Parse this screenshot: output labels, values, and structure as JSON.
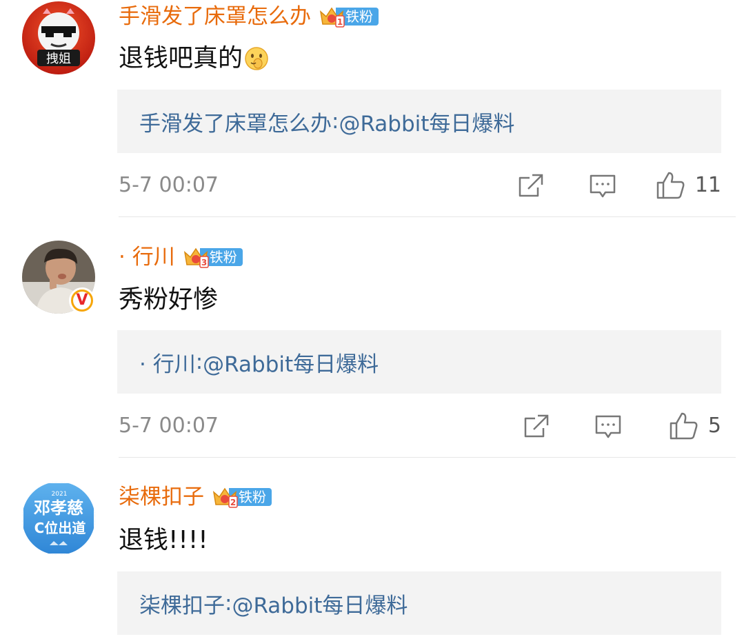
{
  "comments": [
    {
      "username": "手滑发了床罩怎么办",
      "badge_label": "铁粉",
      "badge_level": "1",
      "avatar_text": "拽姐",
      "text": "退钱吧真的",
      "emoji": "smirk-emoji",
      "quote_name": "手滑发了床罩怎么办",
      "quote_sep": ": ",
      "quote_mention": "@Rabbit每日爆料",
      "time": "5-7 00:07",
      "like_count": "11",
      "verified": false
    },
    {
      "username": "· 行川",
      "badge_label": "铁粉",
      "badge_level": "3",
      "avatar_text": "",
      "text": "秀粉好惨",
      "quote_name": "· 行川",
      "quote_sep": ": ",
      "quote_mention": "@Rabbit每日爆料",
      "time": "5-7 00:07",
      "like_count": "5",
      "verified": true,
      "verified_mark": "V"
    },
    {
      "username": "柒棵扣子",
      "badge_label": "铁粉",
      "badge_level": "2",
      "avatar_text_1": "邓孝慈",
      "avatar_text_2": "C位出道",
      "avatar_text_3": "2021",
      "text": "退钱!!!!",
      "quote_name": "柒棵扣子",
      "quote_sep": ": ",
      "quote_mention": "@Rabbit每日爆料",
      "verified": false
    }
  ],
  "colors": {
    "username": "#e86b0c",
    "quote_text": "#3e6a98",
    "quote_bg": "#f3f3f3",
    "badge_bg": "#4aa6e8",
    "meta_text": "#8a8a8a"
  },
  "icons": {
    "share": "share-icon",
    "comment": "comment-icon",
    "like": "thumbs-up-icon",
    "badge": "crown-badge-icon"
  }
}
